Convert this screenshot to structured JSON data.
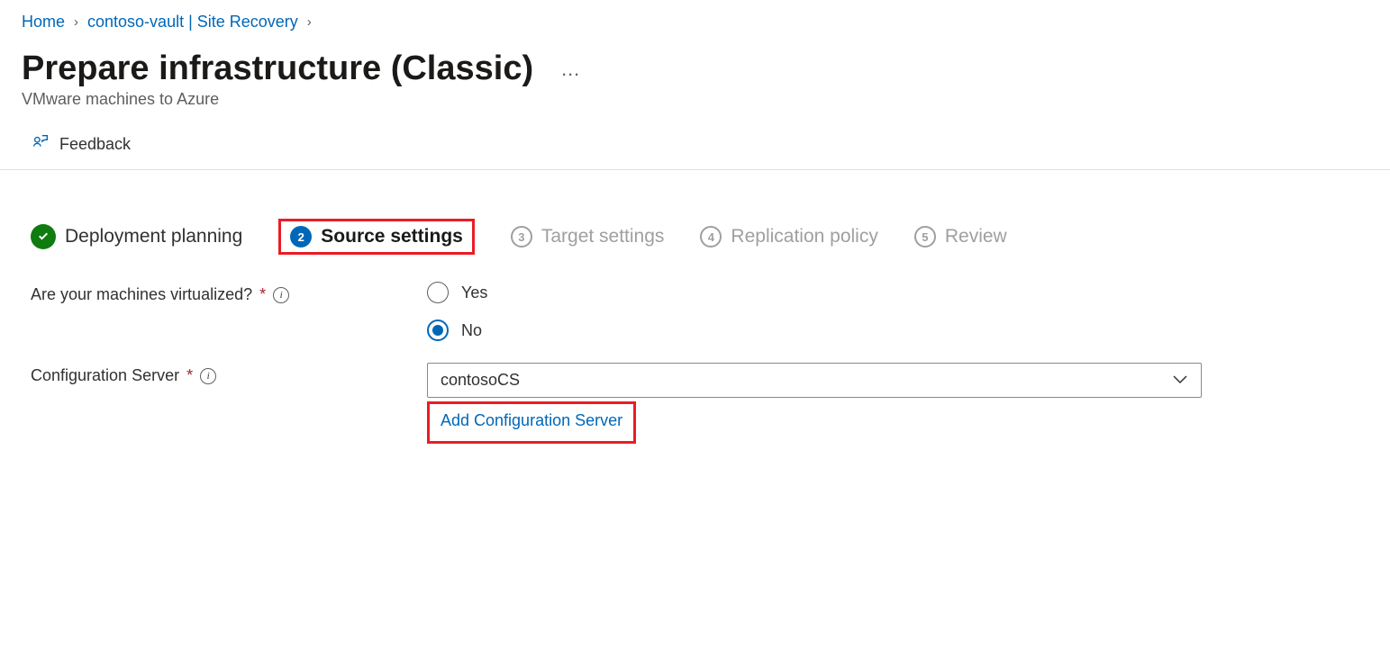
{
  "breadcrumb": {
    "home": "Home",
    "vault": "contoso-vault | Site Recovery"
  },
  "header": {
    "title": "Prepare infrastructure (Classic)",
    "subtitle": "VMware machines to Azure"
  },
  "toolbar": {
    "feedback": "Feedback"
  },
  "steps": {
    "s1": "Deployment planning",
    "s2": "Source settings",
    "s3": "Target settings",
    "s4": "Replication policy",
    "s5": "Review",
    "n2": "2",
    "n3": "3",
    "n4": "4",
    "n5": "5"
  },
  "form": {
    "virtualized_label": "Are your machines virtualized?",
    "opt_yes": "Yes",
    "opt_no": "No",
    "virtualized_value": "No",
    "config_server_label": "Configuration Server",
    "config_server_value": "contosoCS",
    "add_config_link": "Add Configuration Server"
  }
}
